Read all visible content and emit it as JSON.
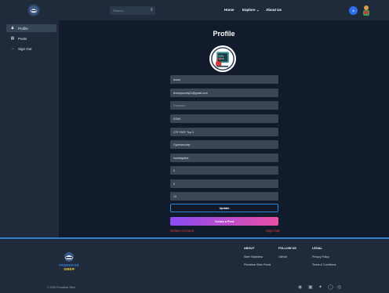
{
  "header": {
    "search_placeholder": "Search...",
    "nav": [
      "Home",
      "Explore ⌄",
      "About Us"
    ],
    "notification_count": "4"
  },
  "sidebar": {
    "items": [
      {
        "icon": "user-icon",
        "label": "Profile"
      },
      {
        "icon": "posts-icon",
        "label": "Posts"
      },
      {
        "icon": "signout-icon",
        "label": "Sign Out"
      }
    ]
  },
  "profile": {
    "title": "Profile",
    "fields": [
      {
        "value": "ferran",
        "placeholder": ""
      },
      {
        "value": "ferranjaconty01@gmail.com",
        "placeholder": ""
      },
      {
        "value": "",
        "placeholder": "Password"
      },
      {
        "value": "KSHK",
        "placeholder": ""
      },
      {
        "value": "CTF 2022' Top 3",
        "placeholder": ""
      },
      {
        "value": "Cybersecurity",
        "placeholder": ""
      },
      {
        "value": "Investigative",
        "placeholder": ""
      },
      {
        "value": "0",
        "placeholder": ""
      },
      {
        "value": "0",
        "placeholder": ""
      },
      {
        "value": "12",
        "placeholder": ""
      }
    ],
    "update_label": "Update",
    "create_post_label": "Create a Post",
    "delete_label": "Delete Account",
    "signout_label": "Sign Out"
  },
  "footer": {
    "logo_text": "PENDEKAR SIBER",
    "about": {
      "heading": "ABOUT",
      "links": [
        "Siber Sejahtera",
        "Pendekar Siber Portal"
      ]
    },
    "follow": {
      "heading": "FOLLOW US",
      "links": [
        "GitHub"
      ]
    },
    "legal": {
      "heading": "LEGAL",
      "links": [
        "Privacy Policy",
        "Terms & Conditions"
      ]
    },
    "copyright": "© 2024 Pendekar Siber",
    "social_icons": [
      "facebook-icon",
      "instagram-icon",
      "twitter-icon",
      "github-icon",
      "dribbble-icon"
    ]
  },
  "colors": {
    "accent": "#2f86d6",
    "danger": "#e33e3e",
    "gradient_start": "#8a4bf2",
    "gradient_end": "#e94fa6"
  }
}
